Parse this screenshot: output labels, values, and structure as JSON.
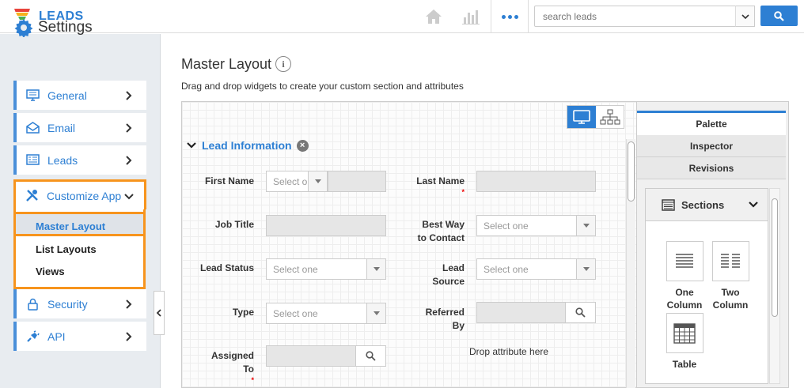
{
  "app": {
    "brand": "LEADS"
  },
  "search": {
    "placeholder": "search leads"
  },
  "sidebar": {
    "title": "Settings",
    "items": [
      {
        "label": "General"
      },
      {
        "label": "Email"
      },
      {
        "label": "Leads"
      },
      {
        "label": "Customize App"
      },
      {
        "label": "Security"
      },
      {
        "label": "API"
      }
    ],
    "subitems": [
      {
        "label": "Master Layout"
      },
      {
        "label": "List Layouts"
      },
      {
        "label": "Views"
      }
    ]
  },
  "main": {
    "title": "Master Layout",
    "info_icon": "i",
    "subtitle": "Drag and drop widgets to create your custom section and attributes",
    "section": {
      "title": "Lead Information",
      "close": "×"
    },
    "fields": [
      {
        "label": "First Name",
        "value": "Select one"
      },
      {
        "label": "Last Name",
        "required": "*"
      },
      {
        "label": "Job Title"
      },
      {
        "label1": "Best Way",
        "label2": "to Contact",
        "value": "Select one"
      },
      {
        "label": "Lead Status",
        "value": "Select one"
      },
      {
        "label1": "Lead",
        "label2": "Source",
        "value": "Select one"
      },
      {
        "label": "Type",
        "value": "Select one"
      },
      {
        "label1": "Referred",
        "label2": "By"
      },
      {
        "label1": "Assigned",
        "label2": "To",
        "required": "*"
      }
    ],
    "drop_text": "Drop attribute here"
  },
  "right_panel": {
    "tabs": [
      "Palette",
      "Inspector",
      "Revisions"
    ],
    "active_tab": "Palette",
    "sections_label": "Sections",
    "widgets": [
      {
        "label1": "One",
        "label2": "Column"
      },
      {
        "label1": "Two",
        "label2": "Column"
      },
      {
        "label": "Table"
      }
    ]
  },
  "colors": {
    "accent": "#2d7fd3",
    "highlight": "#f7941d"
  }
}
